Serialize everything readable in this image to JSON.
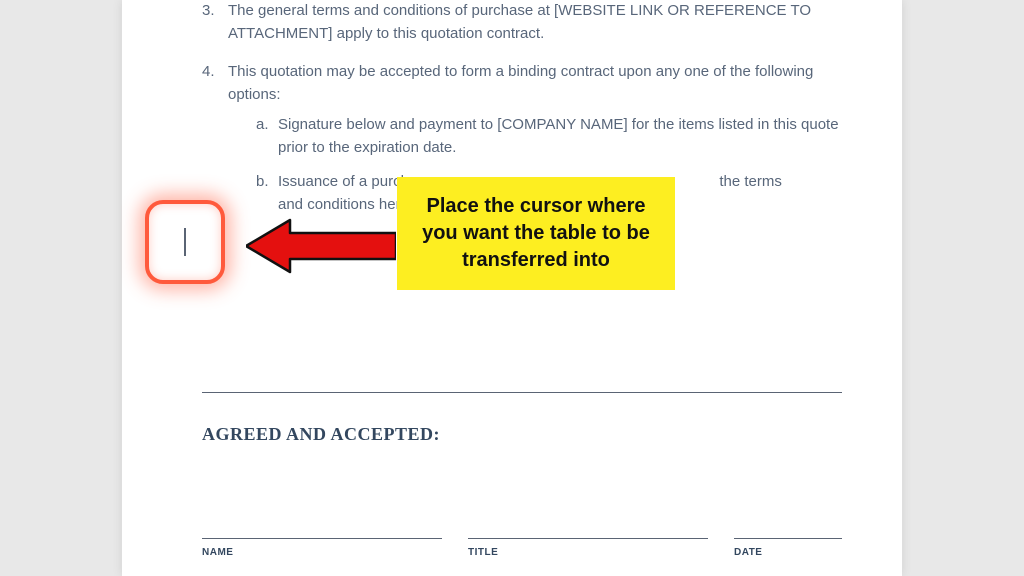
{
  "list": {
    "item3": {
      "num": "3.",
      "text": "The general terms and conditions of purchase at [WEBSITE LINK OR REFERENCE TO ATTACHMENT] apply to this quotation contract."
    },
    "item4": {
      "num": "4.",
      "text": "This quotation may be accepted to form a binding contract upon any one of the following options:",
      "sub_a": {
        "label": "a.",
        "text": "Signature below and payment to [COMPANY NAME] for the items listed in this quote prior to the expiration date."
      },
      "sub_b": {
        "label": "b.",
        "prefix": "Issuance of a purchase orde",
        "suffix": "the terms and conditions herein prior t"
      }
    }
  },
  "callout": "Place the cursor where you want the table to be transferred into",
  "agreed_heading": "AGREED AND ACCEPTED:",
  "signature": {
    "name": "NAME",
    "title": "TITLE",
    "date": "DATE"
  }
}
